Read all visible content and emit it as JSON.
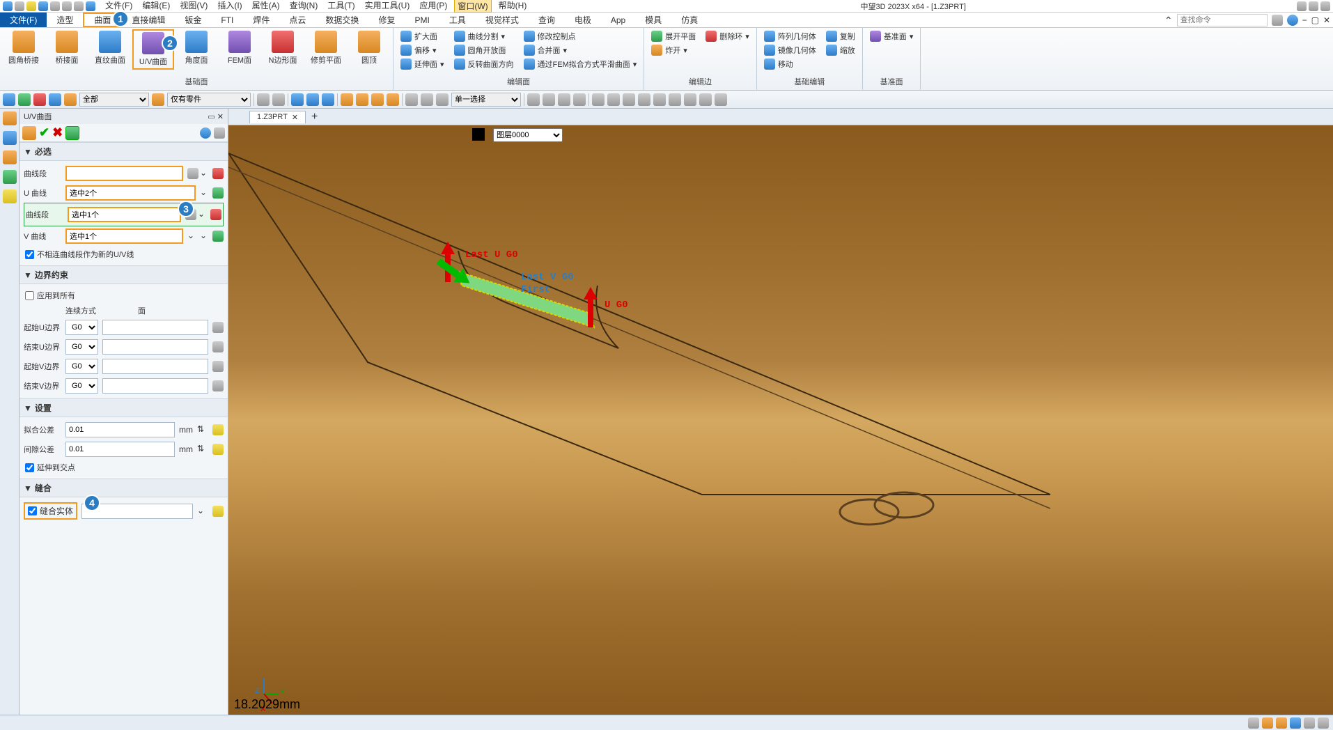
{
  "app_title": "中望3D 2023X x64 - [1.Z3PRT]",
  "menus": [
    "文件(F)",
    "编辑(E)",
    "视图(V)",
    "插入(I)",
    "属性(A)",
    "查询(N)",
    "工具(T)",
    "实用工具(U)",
    "应用(P)",
    "窗口(W)",
    "帮助(H)"
  ],
  "active_menu": "窗口(W)",
  "search_placeholder": "查找命令",
  "ribbon_tabs": [
    "文件(F)",
    "造型",
    "曲面",
    "直接编辑",
    "钣金",
    "FTI",
    "焊件",
    "点云",
    "数据交换",
    "修复",
    "PMI",
    "工具",
    "视觉样式",
    "查询",
    "电极",
    "App",
    "模具",
    "仿真"
  ],
  "ribbon_group1": {
    "label": "基础面",
    "items": [
      "圆角桥接",
      "桥接面",
      "直纹曲面",
      "U/V曲面",
      "角度面",
      "FEM面",
      "N边形面",
      "修剪平面",
      "圆顶"
    ]
  },
  "ribbon_group2": {
    "label": "编辑面",
    "col1": [
      "扩大面",
      "偏移",
      "延伸面"
    ],
    "col2": [
      "曲线分割",
      "圆角开放面",
      "反转曲面方向"
    ],
    "col3": [
      "修改控制点",
      "合并面",
      "通过FEM拟合方式平滑曲面"
    ]
  },
  "ribbon_group3": {
    "label": "编辑边",
    "items": [
      "展开平面",
      "删除环",
      "炸开"
    ]
  },
  "ribbon_group4": {
    "label": "基础编辑",
    "col1": [
      "阵列几何体",
      "镜像几何体",
      "移动"
    ],
    "col2": [
      "复制",
      "缩放"
    ]
  },
  "ribbon_group5": {
    "label": "基准面",
    "item": "基准面"
  },
  "toolbar2": {
    "combo1": "全部",
    "combo2": "仅有零件",
    "combo3": "单一选择"
  },
  "doctab": "1.Z3PRT",
  "layer_combo": "图层0000",
  "panel": {
    "title": "U/V曲面",
    "sec_required": "必选",
    "row_seg1": {
      "label": "曲线段",
      "value": ""
    },
    "row_u": {
      "label": "U 曲线",
      "value": "选中2个"
    },
    "row_seg2": {
      "label": "曲线段",
      "value": "选中1个"
    },
    "row_v": {
      "label": "V 曲线",
      "value": "选中1个"
    },
    "check_discont": "不相连曲线段作为新的U/V线",
    "sec_boundary": "边界约束",
    "check_applyall": "应用到所有",
    "hdr_continuity": "连续方式",
    "hdr_face": "面",
    "bound_rows": [
      {
        "label": "起始U边界",
        "value": "G0"
      },
      {
        "label": "结束U边界",
        "value": "G0"
      },
      {
        "label": "起始V边界",
        "value": "G0"
      },
      {
        "label": "结束V边界",
        "value": "G0"
      }
    ],
    "sec_settings": "设置",
    "tol_fit": {
      "label": "拟合公差",
      "value": "0.01",
      "unit": "mm"
    },
    "tol_gap": {
      "label": "间隙公差",
      "value": "0.01",
      "unit": "mm"
    },
    "check_extend": "延伸到交点",
    "sec_sew": "缝合",
    "check_sew": "缝合实体"
  },
  "viewport": {
    "status": "18.2029mm",
    "label_last_u": "Last U G0",
    "label_last_v": "Last V G0",
    "label_first": "First",
    "label_u_go": "U G0"
  },
  "callouts": {
    "c1": "1",
    "c2": "2",
    "c3": "3",
    "c4": "4"
  }
}
